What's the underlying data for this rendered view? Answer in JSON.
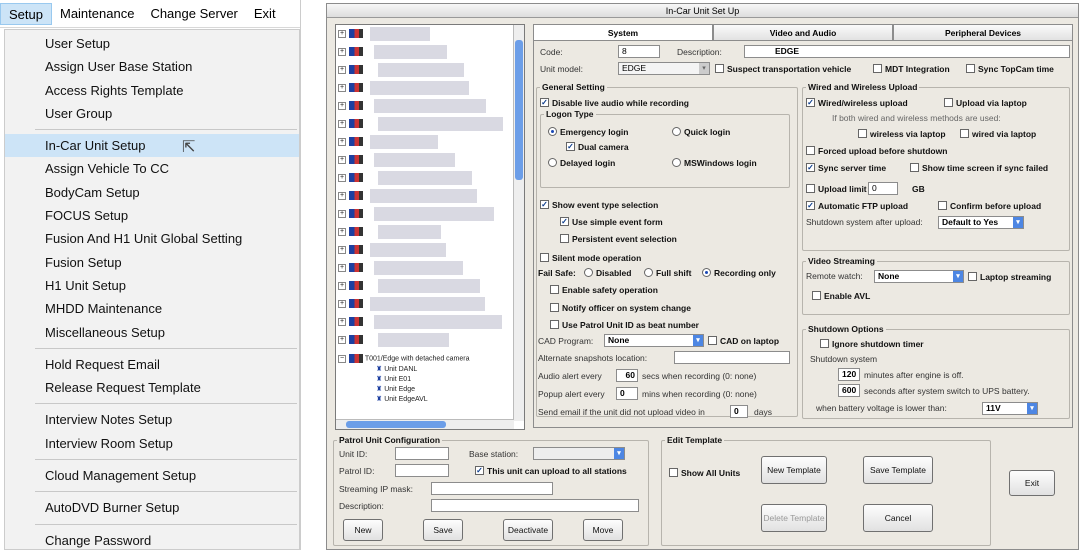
{
  "menubar": {
    "items": [
      "Setup",
      "Maintenance",
      "Change Server",
      "Exit"
    ]
  },
  "menu": {
    "items": [
      "User Setup",
      "Assign User Base Station",
      "Access Rights Template",
      "User Group",
      "In-Car Unit Setup",
      "Assign Vehicle To CC",
      "BodyCam Setup",
      "FOCUS Setup",
      "Fusion And H1 Unit Global Setting",
      "Fusion Setup",
      "H1 Unit Setup",
      "MHDD Maintenance",
      "Miscellaneous Setup",
      "Hold Request Email",
      "Release Request Template",
      "Interview Notes Setup",
      "Interview Room Setup",
      "Cloud Management Setup",
      "AutoDVD Burner Setup",
      "Change Password"
    ],
    "highlighted": "In-Car Unit Setup"
  },
  "window": {
    "title": "In-Car Unit Set Up"
  },
  "tabs": [
    "System",
    "Video and Audio",
    "Peripheral Devices"
  ],
  "tree": {
    "group_label": "T001/Edge with detached camera",
    "units": [
      "Unit DANL",
      "Unit E01",
      "Unit Edge",
      "Unit EdgeAVL"
    ]
  },
  "system": {
    "code_label": "Code:",
    "code_value": "8",
    "description_label": "Description:",
    "description_value": "EDGE",
    "unit_model_label": "Unit model:",
    "unit_model_value": "EDGE",
    "suspect_label": "Suspect transportation vehicle",
    "mdt_label": "MDT Integration",
    "sync_topcam_label": "Sync TopCam time",
    "general": {
      "title": "General Setting",
      "disable_audio": "Disable live audio while recording",
      "logon_title": "Logon Type",
      "emergency": "Emergency login",
      "quick": "Quick login",
      "dual_camera": "Dual camera",
      "delayed": "Delayed login",
      "mswindows": "MSWindows login",
      "show_event": "Show event type selection",
      "simple_event": "Use simple event form",
      "persistent_event": "Persistent event selection",
      "silent": "Silent mode operation",
      "failsafe_label": "Fail Safe:",
      "fs_disabled": "Disabled",
      "fs_full": "Full shift",
      "fs_recording": "Recording only",
      "enable_safety": "Enable safety operation",
      "notify_officer": "Notify officer on system change",
      "use_patrol": "Use Patrol Unit ID as beat number",
      "cad_program_label": "CAD Program:",
      "cad_program_value": "None",
      "cad_laptop": "CAD on laptop",
      "alt_snap_label": "Alternate snapshots location:",
      "audio_alert_label": "Audio alert every",
      "audio_alert_value": "60",
      "audio_alert_suffix": "secs when recording (0: none)",
      "popup_alert_label": "Popup alert every",
      "popup_alert_value": "0",
      "popup_alert_suffix": "mins when recording (0: none)",
      "send_email_label": "Send email if the unit did not upload video in",
      "send_email_value": "0",
      "send_email_suffix": "days"
    },
    "upload": {
      "title": "Wired and Wireless Upload",
      "wired_wireless": "Wired/wireless upload",
      "via_laptop": "Upload via laptop",
      "if_both": "If both wired and wireless methods are used:",
      "wireless_laptop": "wireless via laptop",
      "wired_laptop": "wired via laptop",
      "forced": "Forced upload before shutdown",
      "sync_server": "Sync server time",
      "show_time": "Show time screen if sync failed",
      "upload_limit": "Upload limit",
      "upload_limit_value": "0",
      "gb": "GB",
      "auto_ftp": "Automatic FTP upload",
      "confirm": "Confirm before upload",
      "shutdown_after_label": "Shutdown system after upload:",
      "shutdown_after_value": "Default to Yes"
    },
    "streaming": {
      "title": "Video Streaming",
      "remote_label": "Remote watch:",
      "remote_value": "None",
      "laptop_streaming": "Laptop streaming",
      "enable_avl": "Enable AVL"
    },
    "shutdown": {
      "title": "Shutdown Options",
      "ignore": "Ignore shutdown timer",
      "system_label": "Shutdown system",
      "minutes_value": "120",
      "minutes_suffix": "minutes after engine is off.",
      "seconds_value": "600",
      "seconds_suffix": "seconds after system switch to UPS battery.",
      "battery_label": "when battery voltage is lower than:",
      "battery_value": "11V"
    }
  },
  "patrol": {
    "title": "Patrol Unit Configuration",
    "unit_id_label": "Unit ID:",
    "base_station_label": "Base station:",
    "patrol_id_label": "Patrol ID:",
    "upload_all": "This unit can upload to all stations",
    "streaming_ip_label": "Streaming IP mask:",
    "description_label": "Description:",
    "buttons": [
      "New",
      "Save",
      "Deactivate",
      "Move"
    ]
  },
  "template": {
    "title": "Edit Template",
    "show_all": "Show All Units",
    "new_template": "New Template",
    "save_template": "Save Template",
    "delete_template": "Delete Template",
    "cancel": "Cancel"
  },
  "exit_button": "Exit"
}
